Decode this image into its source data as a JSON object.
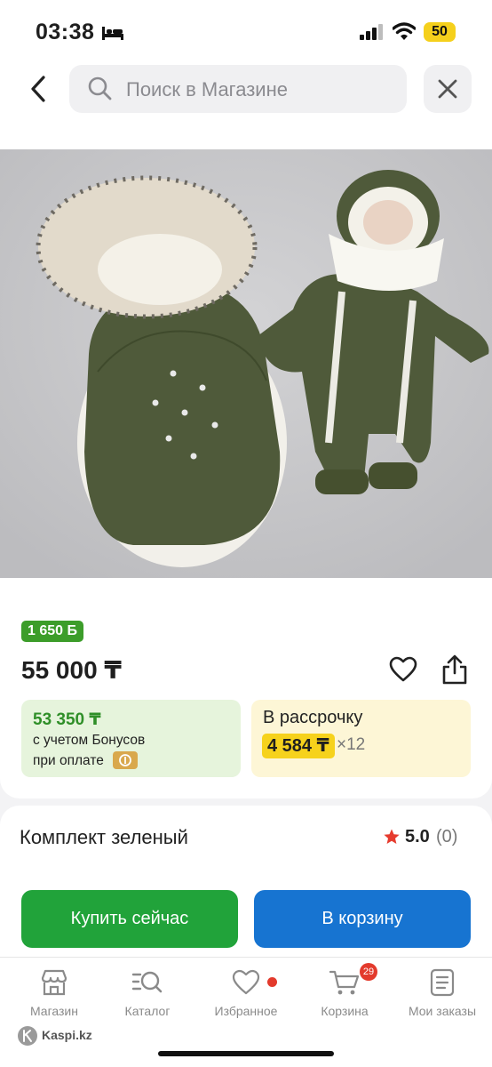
{
  "status_bar": {
    "time": "03:38",
    "battery": "50"
  },
  "search": {
    "placeholder": "Поиск в Магазине"
  },
  "product": {
    "bonus_badge": "1 650 Б",
    "price": "55 000 ₸",
    "bonus_price": "53 350 ₸",
    "bonus_line1": "с учетом Бонусов",
    "bonus_line2": "при оплате",
    "installment_label": "В рассрочку",
    "installment_amount": "4 584 ₸",
    "installment_times": "×12",
    "title": "Комплект зеленый",
    "rating": "5.0",
    "reviews": "(0)"
  },
  "actions": {
    "buy_now": "Купить сейчас",
    "add_to_cart": "В корзину"
  },
  "nav": {
    "items": [
      {
        "label": "Магазин",
        "icon": "store-icon"
      },
      {
        "label": "Каталог",
        "icon": "catalog-search-icon"
      },
      {
        "label": "Избранное",
        "icon": "heart-icon"
      },
      {
        "label": "Корзина",
        "icon": "cart-icon"
      },
      {
        "label": "Мои заказы",
        "icon": "orders-icon"
      }
    ],
    "cart_count": "29"
  },
  "brand": "Kaspi.kz",
  "colors": {
    "green_button": "#21a33a",
    "blue_button": "#1774d1",
    "bonus_green": "#3c9d2a",
    "installment_yellow": "#f6d21c",
    "badge_red": "#e33a2c"
  }
}
